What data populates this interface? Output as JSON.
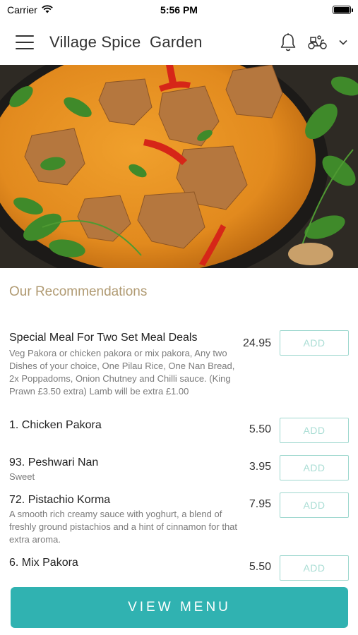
{
  "status_bar": {
    "carrier": "Carrier",
    "time": "5:56 PM",
    "battery_level": 1.0
  },
  "header": {
    "title": "Village Spice  Garden",
    "icons": [
      "menu-icon",
      "bell-icon",
      "scooter-icon",
      "chevron-down-icon"
    ]
  },
  "hero": {
    "image": "curry-dish-photo"
  },
  "recommendations": {
    "title": "Our Recommendations",
    "add_label": "ADD",
    "items": [
      {
        "name": "Special Meal For Two Set Meal Deals",
        "description": "Veg Pakora or chicken pakora or mix pakora, Any two Dishes of your choice, One Pilau Rice, One Nan Bread, 2x Poppadoms, Onion Chutney and Chilli sauce. (King Prawn £3.50 extra) Lamb will be extra £1.00",
        "price": "24.95"
      },
      {
        "name": "1. Chicken Pakora",
        "description": "",
        "price": "5.50"
      },
      {
        "name": "93. Peshwari Nan",
        "description": "Sweet",
        "price": "3.95"
      },
      {
        "name": "72. Pistachio Korma",
        "description": "A smooth rich creamy sauce with yoghurt, a blend of freshly ground pistachios and a hint of cinnamon for that extra aroma.",
        "price": "7.95"
      },
      {
        "name": "6. Mix Pakora",
        "description": "",
        "price": "5.50"
      }
    ]
  },
  "footer": {
    "view_menu_label": "VIEW MENU"
  },
  "colors": {
    "accent": "#30b2b1",
    "section_title": "#b09a72",
    "add_border": "#9fd8cf"
  }
}
